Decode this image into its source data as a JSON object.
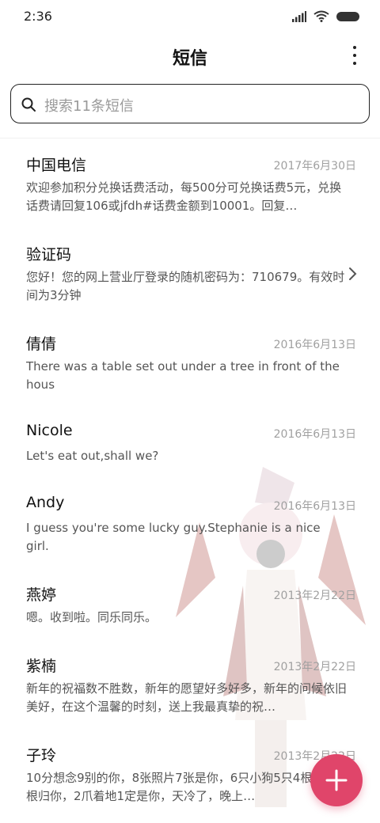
{
  "status_bar": {
    "time": "2:36"
  },
  "header": {
    "title": "短信"
  },
  "search": {
    "placeholder": "搜索11条短信"
  },
  "messages": [
    {
      "name": "中国电信",
      "date": "2017年6月30日",
      "preview": "欢迎参加积分兑换话费活动，每500分可兑换话费5元，兑换话费请回复106或jfdh#话费金额到10001。回复…"
    },
    {
      "name": "验证码",
      "date": "",
      "preview": "您好！您的网上营业厅登录的随机密码为：710679。有效时间为3分钟"
    },
    {
      "name": "倩倩",
      "date": "2016年6月13日",
      "preview": "There was a table set out under a tree in front of the hous"
    },
    {
      "name": "Nicole",
      "date": "2016年6月13日",
      "preview": "Let's eat out,shall we?"
    },
    {
      "name": "Andy",
      "date": "2016年6月13日",
      "preview": "I guess you're some lucky guy.Stephanie is a nice girl."
    },
    {
      "name": "燕婷",
      "date": "2013年2月22日",
      "preview": "嗯。收到啦。同乐同乐。"
    },
    {
      "name": "紫楠",
      "date": "2013年2月22日",
      "preview": "新年的祝福数不胜数，新年的愿望好多好多，新年的问候依旧美好，在这个温馨的时刻，送上我最真挚的祝…"
    },
    {
      "name": "子玲",
      "date": "2013年2月22日",
      "preview": "10分想念9别的你，8张照片7张是你，6只小狗5只4根骨头3根归你，2爪着地1定是你，天冷了，晚上…"
    }
  ],
  "colors": {
    "accent": "#e0456a",
    "date": "#a0a0a0",
    "preview": "#555555"
  }
}
